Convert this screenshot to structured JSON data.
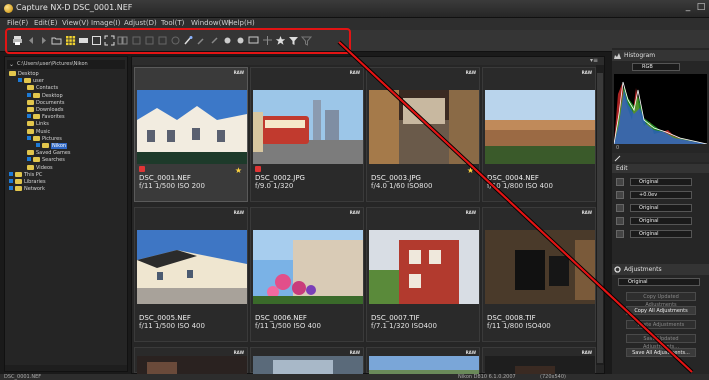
{
  "window": {
    "title": "Capture NX-D    DSC_0001.NEF"
  },
  "menu": [
    "File(F)",
    "Edit(E)",
    "View(V)",
    "Image(I)",
    "Adjust(D)",
    "Tool(T)",
    "Window(W)",
    "Help(H)"
  ],
  "toolbar_icons": [
    "print-icon",
    "back-icon",
    "forward-icon",
    "folder-icon",
    "grid-view-icon",
    "filmstrip-icon",
    "single-view-icon",
    "full-screen-icon",
    "compare-icon",
    "rotate-left-icon",
    "rotate-right-icon",
    "crop-icon",
    "straighten-icon",
    "brush-icon",
    "eyedropper-icon",
    "color-picker-icon",
    "label-icon",
    "rating-icon",
    "filter-icon",
    "clear-filter-icon"
  ],
  "folder_tree": {
    "path": "C:\\Users\\user\\Pictures\\Nikon",
    "items": [
      {
        "label": "Desktop",
        "indent": 0,
        "expander": false
      },
      {
        "label": "user",
        "indent": 1,
        "expander": true
      },
      {
        "label": "Contacts",
        "indent": 2,
        "expander": false
      },
      {
        "label": "Desktop",
        "indent": 2,
        "expander": true
      },
      {
        "label": "Documents",
        "indent": 2,
        "expander": false
      },
      {
        "label": "Downloads",
        "indent": 2,
        "expander": false
      },
      {
        "label": "Favorites",
        "indent": 2,
        "expander": true
      },
      {
        "label": "Links",
        "indent": 2,
        "expander": false
      },
      {
        "label": "Music",
        "indent": 2,
        "expander": false
      },
      {
        "label": "Pictures",
        "indent": 2,
        "expander": true
      },
      {
        "label": "Nikon",
        "indent": 3,
        "expander": true,
        "selected": true
      },
      {
        "label": "Saved Games",
        "indent": 2,
        "expander": false
      },
      {
        "label": "Searches",
        "indent": 2,
        "expander": true
      },
      {
        "label": "Videos",
        "indent": 2,
        "expander": false
      },
      {
        "label": "This PC",
        "indent": 0,
        "expander": true
      },
      {
        "label": "Libraries",
        "indent": 0,
        "expander": true
      },
      {
        "label": "Network",
        "indent": 0,
        "expander": true
      }
    ]
  },
  "thumbnails": [
    {
      "name": "DSC_0001.NEF",
      "meta": "f/11 1/500 ISO 200",
      "label": true,
      "star": true,
      "selected": true
    },
    {
      "name": "DSC_0002.JPG",
      "meta": "f/9.0 1/320",
      "label": true,
      "star": false,
      "selected": false
    },
    {
      "name": "DSC_0003.JPG",
      "meta": "f/4.0 1/60 ISO800",
      "label": false,
      "star": true,
      "selected": false
    },
    {
      "name": "DSC_0004.NEF",
      "meta": "f/10 1/800 ISO 400",
      "label": false,
      "star": false,
      "selected": false
    },
    {
      "name": "DSC_0005.NEF",
      "meta": "f/11 1/500 ISO 400",
      "label": false,
      "star": false,
      "selected": false
    },
    {
      "name": "DSC_0006.NEF",
      "meta": "f/11 1/500 ISO 400",
      "label": false,
      "star": false,
      "selected": false
    },
    {
      "name": "DSC_0007.TIF",
      "meta": "f/7.1 1/320 ISO400",
      "label": false,
      "star": false,
      "selected": false
    },
    {
      "name": "DSC_0008.TIF",
      "meta": "f/11 1/800 ISO400",
      "label": false,
      "star": false,
      "selected": false
    }
  ],
  "raw_badge": "RAW",
  "right": {
    "histogram_title": "Histogram",
    "channel": "RGB",
    "histogram_axis_min": "0",
    "edit_title": "Edit",
    "edit_rows": [
      "Original",
      "+0.0ev",
      "Original",
      "Original",
      "Original"
    ],
    "adjustments_title": "Adjustments",
    "adjustments_select": "Original",
    "buttons": [
      "Copy Updated Adjustments",
      "Copy All Adjustments",
      "Paste Adjustments",
      "Save Updated Adjustments...",
      "Save All Adjustments..."
    ]
  },
  "status": {
    "left": "DSC_0001.NEF",
    "mid": "Nikon D810  6.1.0.2007",
    "mid2": "(720x540)"
  }
}
